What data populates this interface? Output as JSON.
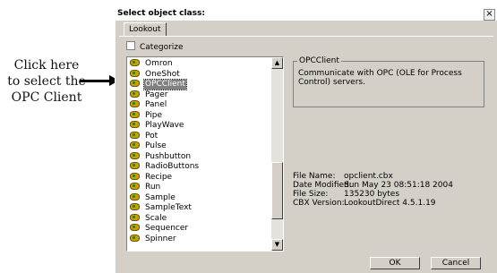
{
  "callout": {
    "line1": "Click here",
    "line2": "to select the",
    "line3": "OPC Client"
  },
  "dialog": {
    "title": "Select object class:",
    "close_label": "×",
    "tab": "Lookout",
    "categorize_label": "Categorize",
    "items": [
      {
        "label": "Omron",
        "selected": false
      },
      {
        "label": "OneShot",
        "selected": false
      },
      {
        "label": "OPCClient",
        "selected": true
      },
      {
        "label": "Pager",
        "selected": false
      },
      {
        "label": "Panel",
        "selected": false
      },
      {
        "label": "Pipe",
        "selected": false
      },
      {
        "label": "PlayWave",
        "selected": false
      },
      {
        "label": "Pot",
        "selected": false
      },
      {
        "label": "Pulse",
        "selected": false
      },
      {
        "label": "Pushbutton",
        "selected": false
      },
      {
        "label": "RadioButtons",
        "selected": false
      },
      {
        "label": "Recipe",
        "selected": false
      },
      {
        "label": "Run",
        "selected": false
      },
      {
        "label": "Sample",
        "selected": false
      },
      {
        "label": "SampleText",
        "selected": false
      },
      {
        "label": "Scale",
        "selected": false
      },
      {
        "label": "Sequencer",
        "selected": false
      },
      {
        "label": "Spinner",
        "selected": false
      }
    ],
    "scroll_up": "▲",
    "scroll_down": "▼",
    "group_title": "OPCClient",
    "description": "Communicate with OPC (OLE for Process Control) servers.",
    "info": {
      "file_name_label": "File Name:",
      "file_name": "opclient.cbx",
      "date_modified_label": "Date Modified:",
      "date_modified": "Sun May 23 08:51:18 2004",
      "file_size_label": "File Size:",
      "file_size": "135230 bytes",
      "cbx_version_label": "CBX Version:",
      "cbx_version": "LookoutDirect 4.5.1.19"
    },
    "ok_label": "OK",
    "cancel_label": "Cancel"
  }
}
